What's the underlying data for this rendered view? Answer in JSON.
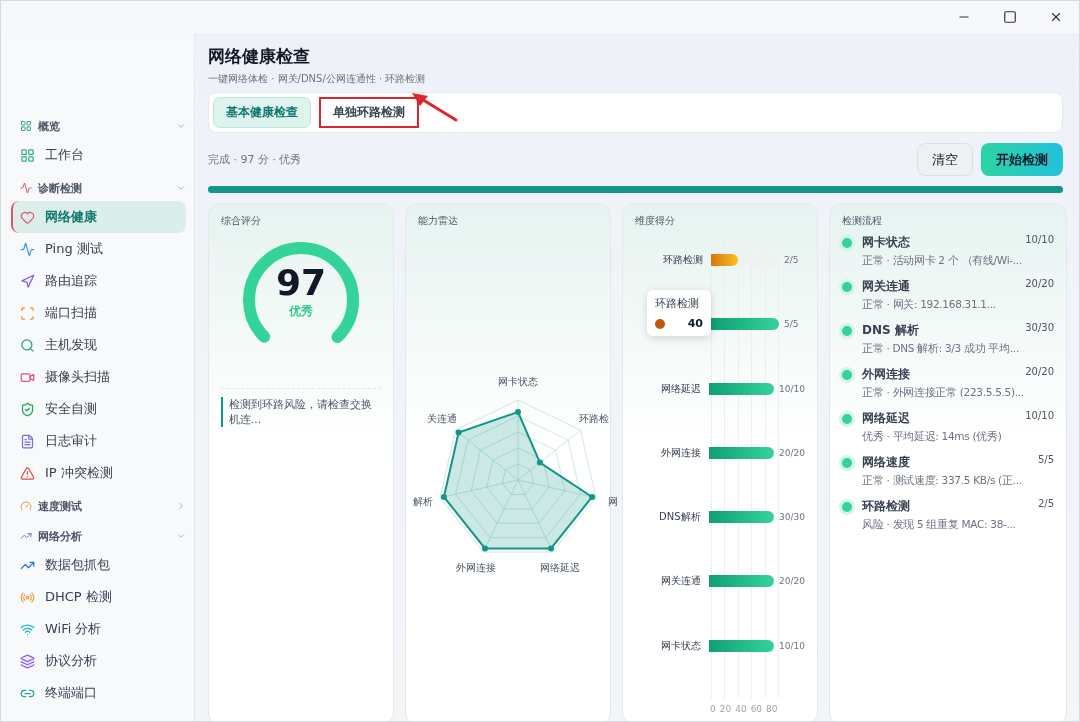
{
  "sidebar": {
    "groups": [
      {
        "label": "概览",
        "expanded": true,
        "items": [
          {
            "label": "工作台",
            "selected": false
          }
        ]
      },
      {
        "label": "诊断检测",
        "expanded": true,
        "items": [
          {
            "label": "网络健康",
            "selected": true
          },
          {
            "label": "Ping 测试",
            "selected": false
          },
          {
            "label": "路由追踪",
            "selected": false
          },
          {
            "label": "端口扫描",
            "selected": false
          },
          {
            "label": "主机发现",
            "selected": false
          },
          {
            "label": "摄像头扫描",
            "selected": false
          },
          {
            "label": "安全自测",
            "selected": false
          },
          {
            "label": "日志审计",
            "selected": false
          },
          {
            "label": "IP 冲突检测",
            "selected": false
          }
        ]
      },
      {
        "label": "速度测试",
        "expanded": false
      },
      {
        "label": "网络分析",
        "expanded": true,
        "items": [
          {
            "label": "数据包抓包",
            "selected": false
          },
          {
            "label": "DHCP 检测",
            "selected": false
          },
          {
            "label": "WiFi 分析",
            "selected": false
          },
          {
            "label": "协议分析",
            "selected": false
          },
          {
            "label": "终端端口",
            "selected": false
          }
        ]
      }
    ]
  },
  "page": {
    "title": "网络健康检查",
    "subtitle": "一键网络体检 · 网关/DNS/公网连通性 · 环路检测"
  },
  "tabs": [
    {
      "label": "基本健康检查",
      "selected": true,
      "highlighted": false
    },
    {
      "label": "单独环路检测",
      "selected": false,
      "highlighted": true
    }
  ],
  "status": "完成 · 97 分 · 优秀",
  "buttons": [
    {
      "label": "清空",
      "kind": "secondary"
    },
    {
      "label": "开始检测",
      "kind": "primary"
    }
  ],
  "progress": {
    "level": 1
  },
  "score_card": {
    "title": "综合评分",
    "score": "97",
    "grade": "优秀",
    "note": "检测到环路风险，请检查交换机连..."
  },
  "radar_card": {
    "title": "能力雷达",
    "axes": [
      "网卡状态",
      "环路检",
      "网",
      "网络延迟",
      "外网连接",
      "解析",
      "关连通"
    ]
  },
  "bars_card": {
    "title": "维度得分",
    "rows": [
      {
        "label": "环路检测",
        "reading": "2/5",
        "level": 0.4,
        "kind": "warn"
      },
      {
        "reading": "5/5",
        "level": 1,
        "kind": "ok"
      },
      {
        "label": "网络延迟",
        "reading": "10/10",
        "level": 1,
        "kind": "ok"
      },
      {
        "label": "外网连接",
        "reading": "20/20",
        "level": 1,
        "kind": "ok"
      },
      {
        "label": "DNS解析",
        "reading": "30/30",
        "level": 1,
        "kind": "ok"
      },
      {
        "label": "网关连通",
        "reading": "20/20",
        "level": 1,
        "kind": "ok"
      },
      {
        "label": "网卡状态",
        "reading": "10/10",
        "level": 1,
        "kind": "ok"
      }
    ],
    "ticks": [
      "0",
      "20",
      "40",
      "60",
      "80"
    ],
    "tooltip": {
      "title": "环路检测",
      "value": "40",
      "color": "#c2570c"
    }
  },
  "flow_card": {
    "title": "检测流程",
    "steps": [
      {
        "title": "网卡状态",
        "score": "10/10",
        "detail": "正常 · 活动网卡 2 个 （有线/Wi-..."
      },
      {
        "title": "网关连通",
        "score": "20/20",
        "detail": "正常 · 网关: 192.168.31.1..."
      },
      {
        "title": "DNS 解析",
        "score": "30/30",
        "detail": "正常 · DNS 解析: 3/3 成功 平均..."
      },
      {
        "title": "外网连接",
        "score": "20/20",
        "detail": "正常 · 外网连接正常 (223.5.5.5)..."
      },
      {
        "title": "网络延迟",
        "score": "10/10",
        "detail": "优秀 · 平均延迟: 14ms (优秀)"
      },
      {
        "title": "网络速度",
        "score": "5/5",
        "detail": "正常 · 测试速度: 337.5 KB/s (正..."
      },
      {
        "title": "环路检测",
        "score": "2/5",
        "detail": "风险 · 发现 5 组重复 MAC: 38-..."
      }
    ]
  }
}
